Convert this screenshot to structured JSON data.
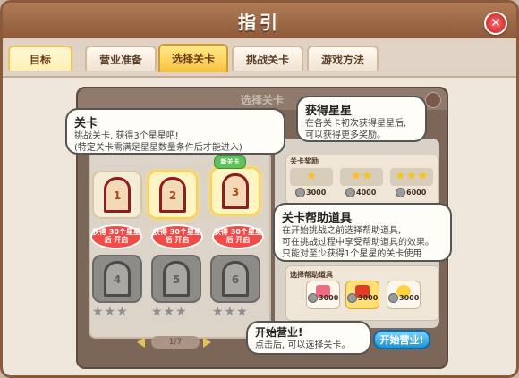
{
  "window": {
    "title": "指引",
    "close_icon": "close-icon"
  },
  "tabs": [
    {
      "label": "目标"
    },
    {
      "label": "营业准备"
    },
    {
      "label": "选择关卡"
    },
    {
      "label": "挑战关卡"
    },
    {
      "label": "游戏方法"
    }
  ],
  "panel": {
    "title": "选择关卡"
  },
  "stages": [
    {
      "num": "1"
    },
    {
      "num": "2"
    },
    {
      "num": "3"
    },
    {
      "num": "4"
    },
    {
      "num": "5"
    },
    {
      "num": "6"
    }
  ],
  "new_tag": "新关卡",
  "requirement": "获得\n30个星星后\n开启",
  "stars_empty": "★★★",
  "pager": {
    "text": "1/7"
  },
  "bubbles": {
    "stage": {
      "title": "关卡",
      "text": "挑战关卡, 获得3个星星吧!\n(特定关卡需满足星星数量条件后才能进入)"
    },
    "stars": {
      "title": "获得星星",
      "text": "在各关卡初次获得星星后,\n可以获得更多奖励。"
    },
    "tools": {
      "title": "关卡帮助道具",
      "text": "在开始挑战之前选择帮助道具,\n可在挑战过程中享受帮助道具的效果。\n只能对至少获得1个星星的关卡使用"
    },
    "start": {
      "title": "开始营业!",
      "text": "点击后, 可以选择关卡。"
    }
  },
  "rewards": {
    "label": "关卡奖励",
    "items": [
      {
        "stars": "★",
        "coins": "3000"
      },
      {
        "stars": "★★",
        "coins": "4000"
      },
      {
        "stars": "★★★",
        "coins": "6000"
      }
    ]
  },
  "tools": {
    "label": "选择帮助道具",
    "items": [
      {
        "price": "3000"
      },
      {
        "price": "3000"
      },
      {
        "price": "3000"
      }
    ]
  },
  "start_button": "开始营业!",
  "colors": {
    "frame": "#8a5a3c",
    "active_tab": "#f6c23d",
    "star": "#f6c21d",
    "start_button": "#1d92d6"
  }
}
